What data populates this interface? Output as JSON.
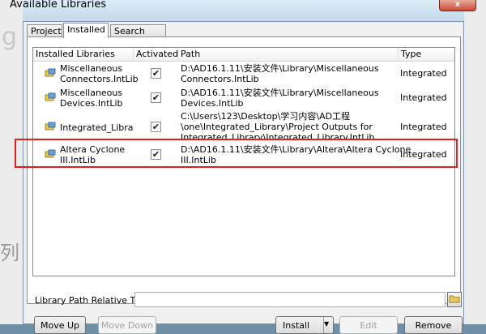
{
  "window": {
    "title": "Available Libraries",
    "close_label": "x"
  },
  "background": {
    "left_glyph": "列",
    "left_glyph_top": "g"
  },
  "tabs": [
    {
      "label": "Project"
    },
    {
      "label": "Installed"
    },
    {
      "label": "Search Path"
    }
  ],
  "table": {
    "columns": [
      "Installed Libraries",
      "Activated",
      "Path",
      "Type"
    ],
    "rows": [
      {
        "name_line1": "Miscellaneous",
        "name_line2": "Connectors.IntLib",
        "activated": "✔",
        "path_line1": "D:\\AD16.1.11\\安装文件\\Library\\Miscellaneous",
        "path_line2": "Connectors.IntLib",
        "path_line3": "",
        "type": "Integrated"
      },
      {
        "name_line1": "Miscellaneous",
        "name_line2": "Devices.IntLib",
        "activated": "✔",
        "path_line1": "D:\\AD16.1.11\\安装文件\\Library\\Miscellaneous",
        "path_line2": "Devices.IntLib",
        "path_line3": "",
        "type": "Integrated"
      },
      {
        "name_line1": "Integrated_Library",
        "name_line2": "",
        "activated": "✔",
        "path_line1": "C:\\Users\\123\\Desktop\\学习内容\\AD工程",
        "path_line2": "\\one\\Integrated_Library\\Project Outputs for",
        "path_line3": "Integrated_Library\\Integrated_Library.IntLib",
        "type": "Integrated"
      },
      {
        "name_line1": "Altera Cyclone",
        "name_line2": "III.IntLib",
        "activated": "✔",
        "path_line1": "D:\\AD16.1.11\\安装文件\\Library\\Altera\\Altera Cyclone",
        "path_line2": "III.IntLib",
        "path_line3": "",
        "type": "Integrated"
      }
    ]
  },
  "footer": {
    "path_label": "Library Path Relative To:",
    "path_value": ""
  },
  "buttons": {
    "move_up": "Move Up",
    "move_down": "Move Down",
    "install": "Install",
    "install_arrow": "▼",
    "edit": "Edit",
    "remove": "Remove"
  },
  "colors": {
    "highlight_border": "#e31e1e",
    "window_frame": "#c3d7e9"
  }
}
